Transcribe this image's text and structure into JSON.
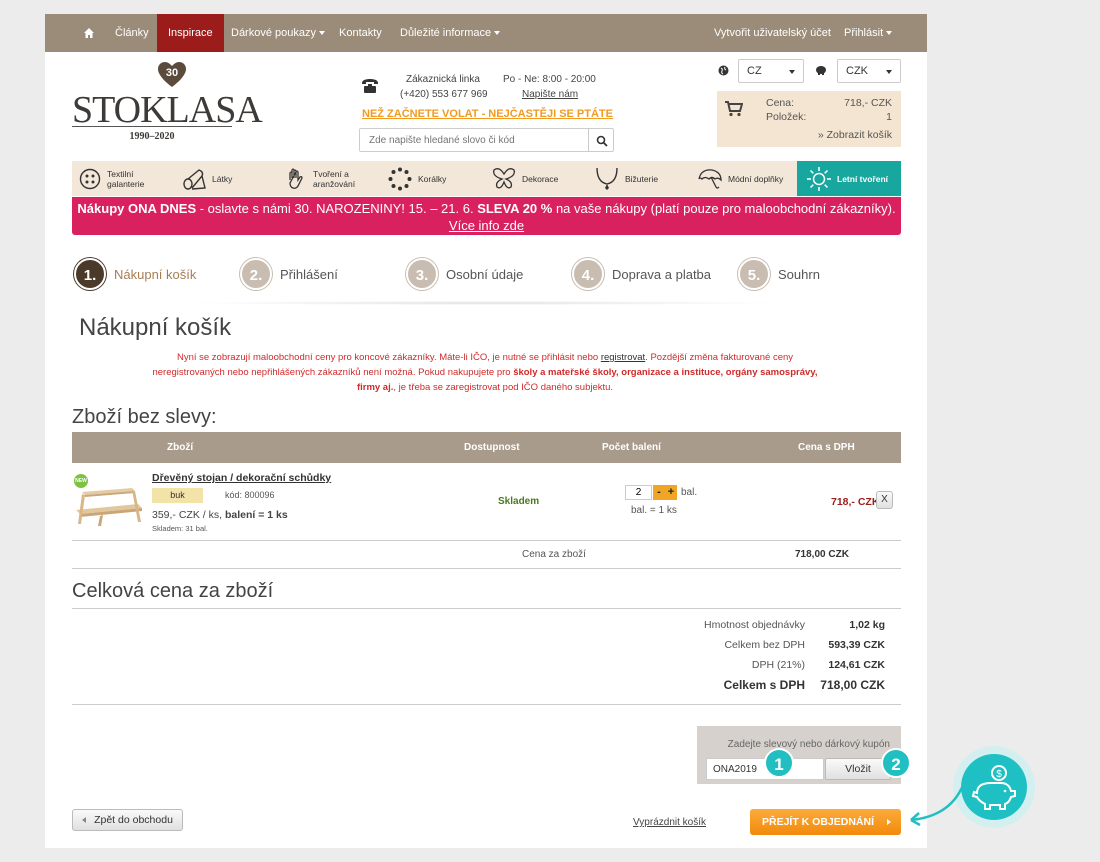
{
  "nav": {
    "items": [
      {
        "label": "Články"
      },
      {
        "label": "Inspirace"
      },
      {
        "label": "Dárkové poukazy"
      },
      {
        "label": "Kontakty"
      },
      {
        "label": "Důležité informace"
      }
    ],
    "create_account": "Vytvořit uživatelský účet",
    "login": "Přihlásit"
  },
  "logo": {
    "anniversary": "30",
    "name": "STOKLASA",
    "years": "1990–2020"
  },
  "contact": {
    "line_label": "Zákaznická linka",
    "phone": "(+420) 553 677 969",
    "hours": "Po - Ne: 8:00 - 20:00",
    "write_us": "Napište nám",
    "faq": "NEŽ ZAČNETE VOLAT - NEJČASTĚJI SE PTÁTE"
  },
  "search": {
    "placeholder": "Zde napište hledané slovo či kód"
  },
  "country": "CZ",
  "currency": "CZK",
  "cart": {
    "price_label": "Cena:",
    "price": "718,- CZK",
    "items_label": "Položek:",
    "items": "1",
    "show": "» Zobrazit košík"
  },
  "categories": [
    {
      "label": "Textilní galanterie",
      "icon": "buttons-icon"
    },
    {
      "label": "Látky",
      "icon": "fabric-roll-icon"
    },
    {
      "label": "Tvoření a aranžování",
      "icon": "hand-heart-icon"
    },
    {
      "label": "Korálky",
      "icon": "beads-icon"
    },
    {
      "label": "Dekorace",
      "icon": "butterfly-icon"
    },
    {
      "label": "Bižuterie",
      "icon": "necklace-icon"
    },
    {
      "label": "Módní doplňky",
      "icon": "umbrella-icon"
    },
    {
      "label": "Letní tvoření",
      "icon": "sun-icon"
    }
  ],
  "banner": {
    "b1": "Nákupy ONA DNES",
    "t1": " - oslavte s námi 30. NAROZENINY! 15. – 21. 6. ",
    "b2": "SLEVA 20 %",
    "t2": " na vaše nákupy (platí pouze pro maloobchodní zákazníky). ",
    "link": "Více info zde"
  },
  "steps": [
    {
      "num": "1.",
      "label": "Nákupní košík"
    },
    {
      "num": "2.",
      "label": "Přihlášení"
    },
    {
      "num": "3.",
      "label": "Osobní údaje"
    },
    {
      "num": "4.",
      "label": "Doprava a platba"
    },
    {
      "num": "5.",
      "label": "Souhrn"
    }
  ],
  "page_title": "Nákupní košík",
  "notice": {
    "p1": "Nyní se zobrazují maloobchodní ceny pro koncové zákazníky. Máte-li IČO, je nutné se přihlásit nebo ",
    "link": "registrovat",
    "p2": ". Pozdější změna fakturované ceny neregistrovaných nebo nepřihlášených zákazníků není možná. Pokud nakupujete pro ",
    "bold": "školy a mateřské školy, organizace a instituce, orgány samosprávy, firmy aj.",
    "p3": ", je třeba se zaregistrovat pod IČO daného subjektu."
  },
  "section_title": "Zboží bez slevy:",
  "table": {
    "headers": [
      "Zboží",
      "Dostupnost",
      "Počet balení",
      "Cena s DPH"
    ],
    "row": {
      "new_badge": "NEW",
      "name": "Dřevěný stojan / dekorační schůdky",
      "variant": "buk",
      "code": "kód: 800096",
      "unit_price": "359,- CZK / ks, ",
      "pack": "balení = 1 ks",
      "stock": "Skladem: 31 bal.",
      "availability": "Skladem",
      "qty": "2",
      "minus": "-",
      "plus": "+",
      "qty_unit": "bal.",
      "pack_info": "bal. = 1 ks",
      "price": "718,- CZK",
      "remove": "X"
    },
    "subtotal_label": "Cena za zboží",
    "subtotal": "718,00 CZK"
  },
  "total_title": "Celková cena za zboží",
  "summary": [
    {
      "label": "Hmotnost objednávky",
      "value": "1,02 kg"
    },
    {
      "label": "Celkem bez DPH",
      "value": "593,39 CZK"
    },
    {
      "label": "DPH (21%)",
      "value": "124,61 CZK"
    },
    {
      "label": "Celkem s DPH",
      "value": "718,00 CZK"
    }
  ],
  "coupon": {
    "label": "Zadejte slevový nebo dárkový kupón",
    "value": "ONA2019",
    "apply": "Vložit",
    "badge1": "1",
    "badge2": "2"
  },
  "actions": {
    "back": "Zpět do obchodu",
    "empty": "Vyprázdnit košík",
    "proceed": "PŘEJÍT K OBJEDNÁNÍ"
  },
  "colors": {
    "nav": "#9b8b79",
    "active": "#9c1c1c",
    "banner": "#d9215f",
    "accent": "#22bfc2",
    "cta": "#f7941d"
  }
}
